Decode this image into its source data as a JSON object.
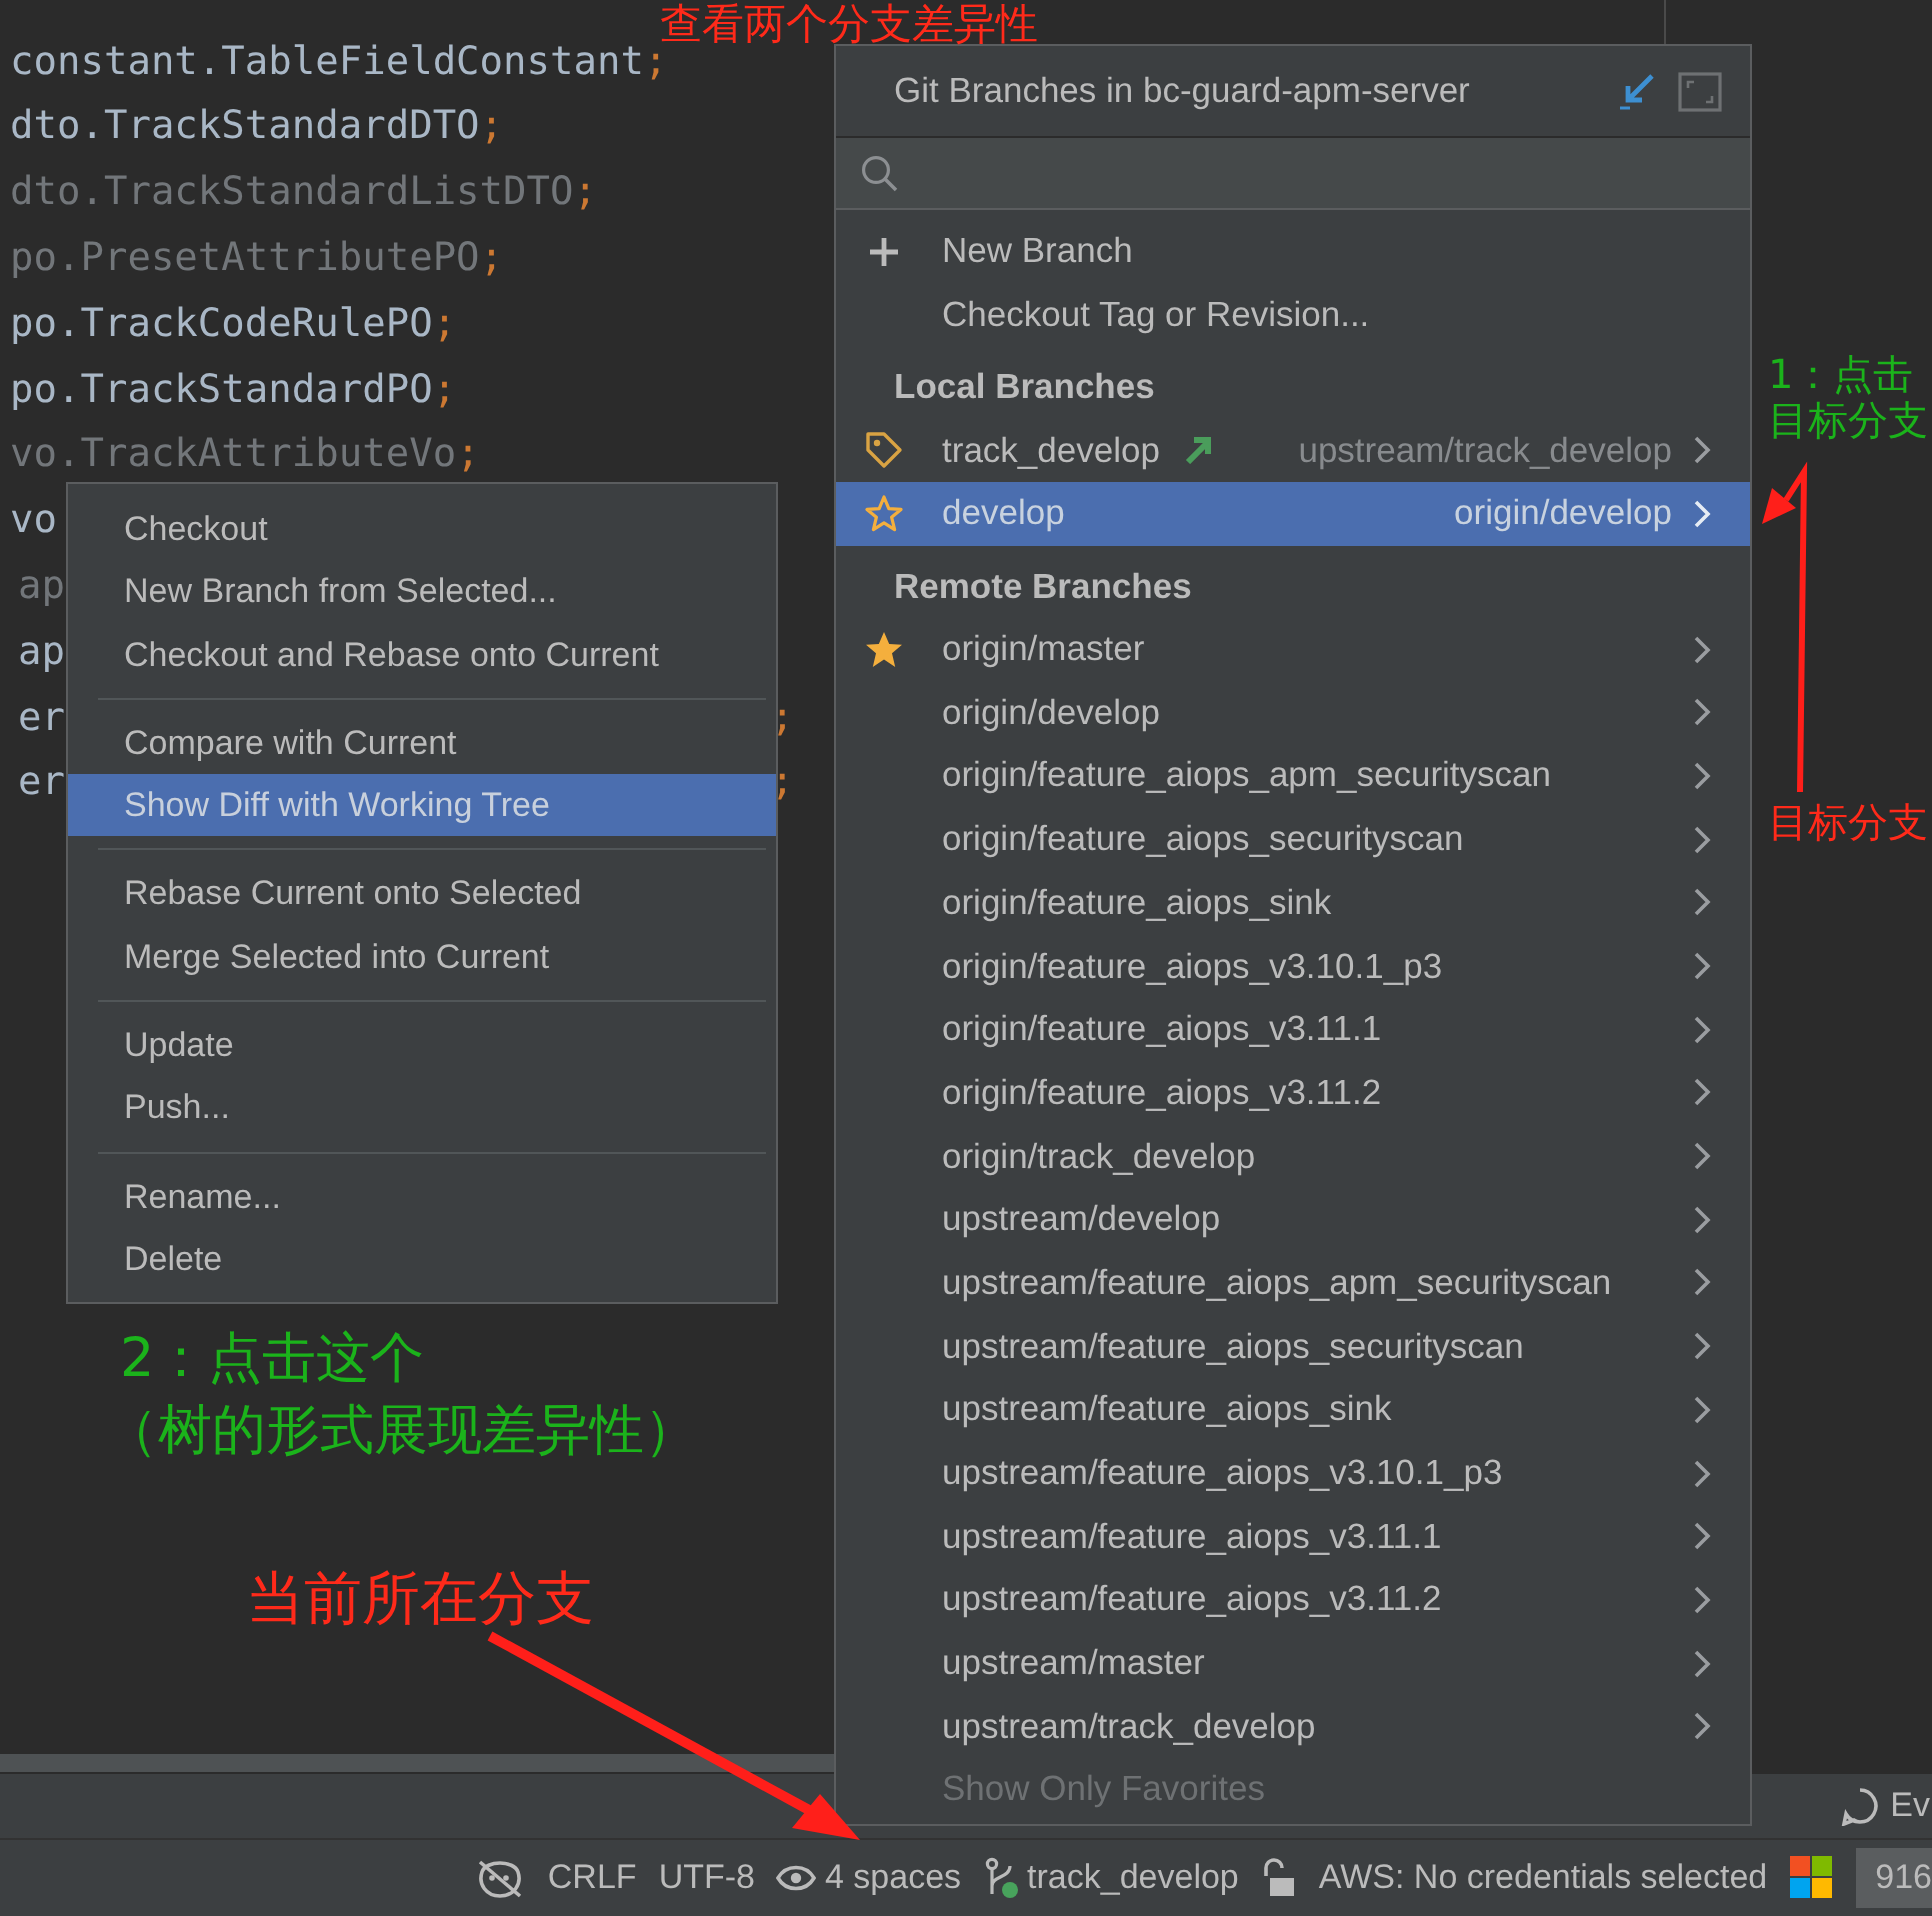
{
  "editor": {
    "lines": [
      {
        "text": "constant.TableFieldConstant",
        "punct": ";",
        "unused": false,
        "kind": "full"
      },
      {
        "text": "dto.TrackStandardDTO",
        "punct": ";",
        "unused": false,
        "kind": "full"
      },
      {
        "text": "dto.TrackStandardListDTO",
        "punct": ";",
        "unused": true,
        "kind": "full"
      },
      {
        "text": "po.PresetAttributePO",
        "punct": ";",
        "unused": true,
        "kind": "full"
      },
      {
        "text": "po.TrackCodeRulePO",
        "punct": ";",
        "unused": false,
        "kind": "full"
      },
      {
        "text": "po.TrackStandardPO",
        "punct": ";",
        "unused": false,
        "kind": "full"
      },
      {
        "text": "vo.TrackAttributeVo",
        "punct": ";",
        "unused": true,
        "kind": "full"
      },
      {
        "text": "vo",
        "unused": false,
        "kind": "full"
      },
      {
        "text": "ap",
        "unused": true,
        "kind": "cut"
      },
      {
        "text": "ap",
        "unused": false,
        "kind": "cut"
      },
      {
        "text": "er",
        "punct": ";",
        "unused": false,
        "kind": "cut"
      },
      {
        "text": "er",
        "punct": ";",
        "unused": false,
        "kind": "cut"
      }
    ]
  },
  "context_menu": {
    "groups": [
      [
        {
          "label": "Checkout",
          "selected": false
        },
        {
          "label": "New Branch from Selected...",
          "selected": false
        },
        {
          "label": "Checkout and Rebase onto Current",
          "selected": false
        }
      ],
      [
        {
          "label": "Compare with Current",
          "selected": false
        },
        {
          "label": "Show Diff with Working Tree",
          "selected": true
        }
      ],
      [
        {
          "label": "Rebase Current onto Selected",
          "selected": false
        },
        {
          "label": "Merge Selected into Current",
          "selected": false
        }
      ],
      [
        {
          "label": "Update",
          "selected": false
        },
        {
          "label": "Push...",
          "selected": false
        }
      ],
      [
        {
          "label": "Rename...",
          "selected": false
        },
        {
          "label": "Delete",
          "selected": false
        }
      ]
    ]
  },
  "branch_popup": {
    "title": "Git Branches in bc-guard-apm-server",
    "actions": [
      {
        "label": "New Branch",
        "kind": "new"
      },
      {
        "label": "Checkout Tag or Revision...",
        "kind": "plain"
      }
    ],
    "sections": [
      {
        "title": "Local Branches",
        "branches": [
          {
            "name": "track_develop",
            "tracking": "upstream/track_develop",
            "current": true,
            "outgoing": true,
            "favorite": false,
            "selected": false
          },
          {
            "name": "develop",
            "tracking": "origin/develop",
            "current": false,
            "outgoing": false,
            "favorite": false,
            "selected": true
          }
        ]
      },
      {
        "title": "Remote Branches",
        "branches": [
          {
            "name": "origin/master",
            "current": false,
            "outgoing": false,
            "favorite": true,
            "selected": false
          },
          {
            "name": "origin/develop",
            "current": false,
            "outgoing": false,
            "favorite": false,
            "selected": false
          },
          {
            "name": "origin/feature_aiops_apm_securityscan",
            "current": false,
            "outgoing": false,
            "favorite": false,
            "selected": false
          },
          {
            "name": "origin/feature_aiops_securityscan",
            "current": false,
            "outgoing": false,
            "favorite": false,
            "selected": false
          },
          {
            "name": "origin/feature_aiops_sink",
            "current": false,
            "outgoing": false,
            "favorite": false,
            "selected": false
          },
          {
            "name": "origin/feature_aiops_v3.10.1_p3",
            "current": false,
            "outgoing": false,
            "favorite": false,
            "selected": false
          },
          {
            "name": "origin/feature_aiops_v3.11.1",
            "current": false,
            "outgoing": false,
            "favorite": false,
            "selected": false
          },
          {
            "name": "origin/feature_aiops_v3.11.2",
            "current": false,
            "outgoing": false,
            "favorite": false,
            "selected": false
          },
          {
            "name": "origin/track_develop",
            "current": false,
            "outgoing": false,
            "favorite": false,
            "selected": false
          },
          {
            "name": "upstream/develop",
            "current": false,
            "outgoing": false,
            "favorite": false,
            "selected": false
          },
          {
            "name": "upstream/feature_aiops_apm_securityscan",
            "current": false,
            "outgoing": false,
            "favorite": false,
            "selected": false
          },
          {
            "name": "upstream/feature_aiops_securityscan",
            "current": false,
            "outgoing": false,
            "favorite": false,
            "selected": false
          },
          {
            "name": "upstream/feature_aiops_sink",
            "current": false,
            "outgoing": false,
            "favorite": false,
            "selected": false
          },
          {
            "name": "upstream/feature_aiops_v3.10.1_p3",
            "current": false,
            "outgoing": false,
            "favorite": false,
            "selected": false
          },
          {
            "name": "upstream/feature_aiops_v3.11.1",
            "current": false,
            "outgoing": false,
            "favorite": false,
            "selected": false
          },
          {
            "name": "upstream/feature_aiops_v3.11.2",
            "current": false,
            "outgoing": false,
            "favorite": false,
            "selected": false
          },
          {
            "name": "upstream/master",
            "current": false,
            "outgoing": false,
            "favorite": false,
            "selected": false
          },
          {
            "name": "upstream/track_develop",
            "current": false,
            "outgoing": false,
            "favorite": false,
            "selected": false
          }
        ]
      }
    ],
    "footer": {
      "label": "Show Only Favorites",
      "disabled": true
    }
  },
  "tool_strip": {
    "event_log": "Ev"
  },
  "status_bar": {
    "line_separator": "CRLF",
    "encoding": "UTF-8",
    "indent": "4 spaces",
    "branch": "track_develop",
    "aws": "AWS: No credentials selected",
    "memory": "916"
  },
  "annotations": [
    {
      "text": "查看两个分支差异性",
      "color": "#ff2a1a"
    },
    {
      "text": "1：点击目标分支",
      "color": "#1bb31b"
    },
    {
      "text": "2：点击这个",
      "color": "#1bb31b"
    },
    {
      "text": "（树的形式展现差异性）",
      "color": "#1bb31b"
    },
    {
      "text": "目标分支",
      "color": "#ff2a1a"
    },
    {
      "text": "当前所在分支",
      "color": "#ff2a1a"
    }
  ]
}
